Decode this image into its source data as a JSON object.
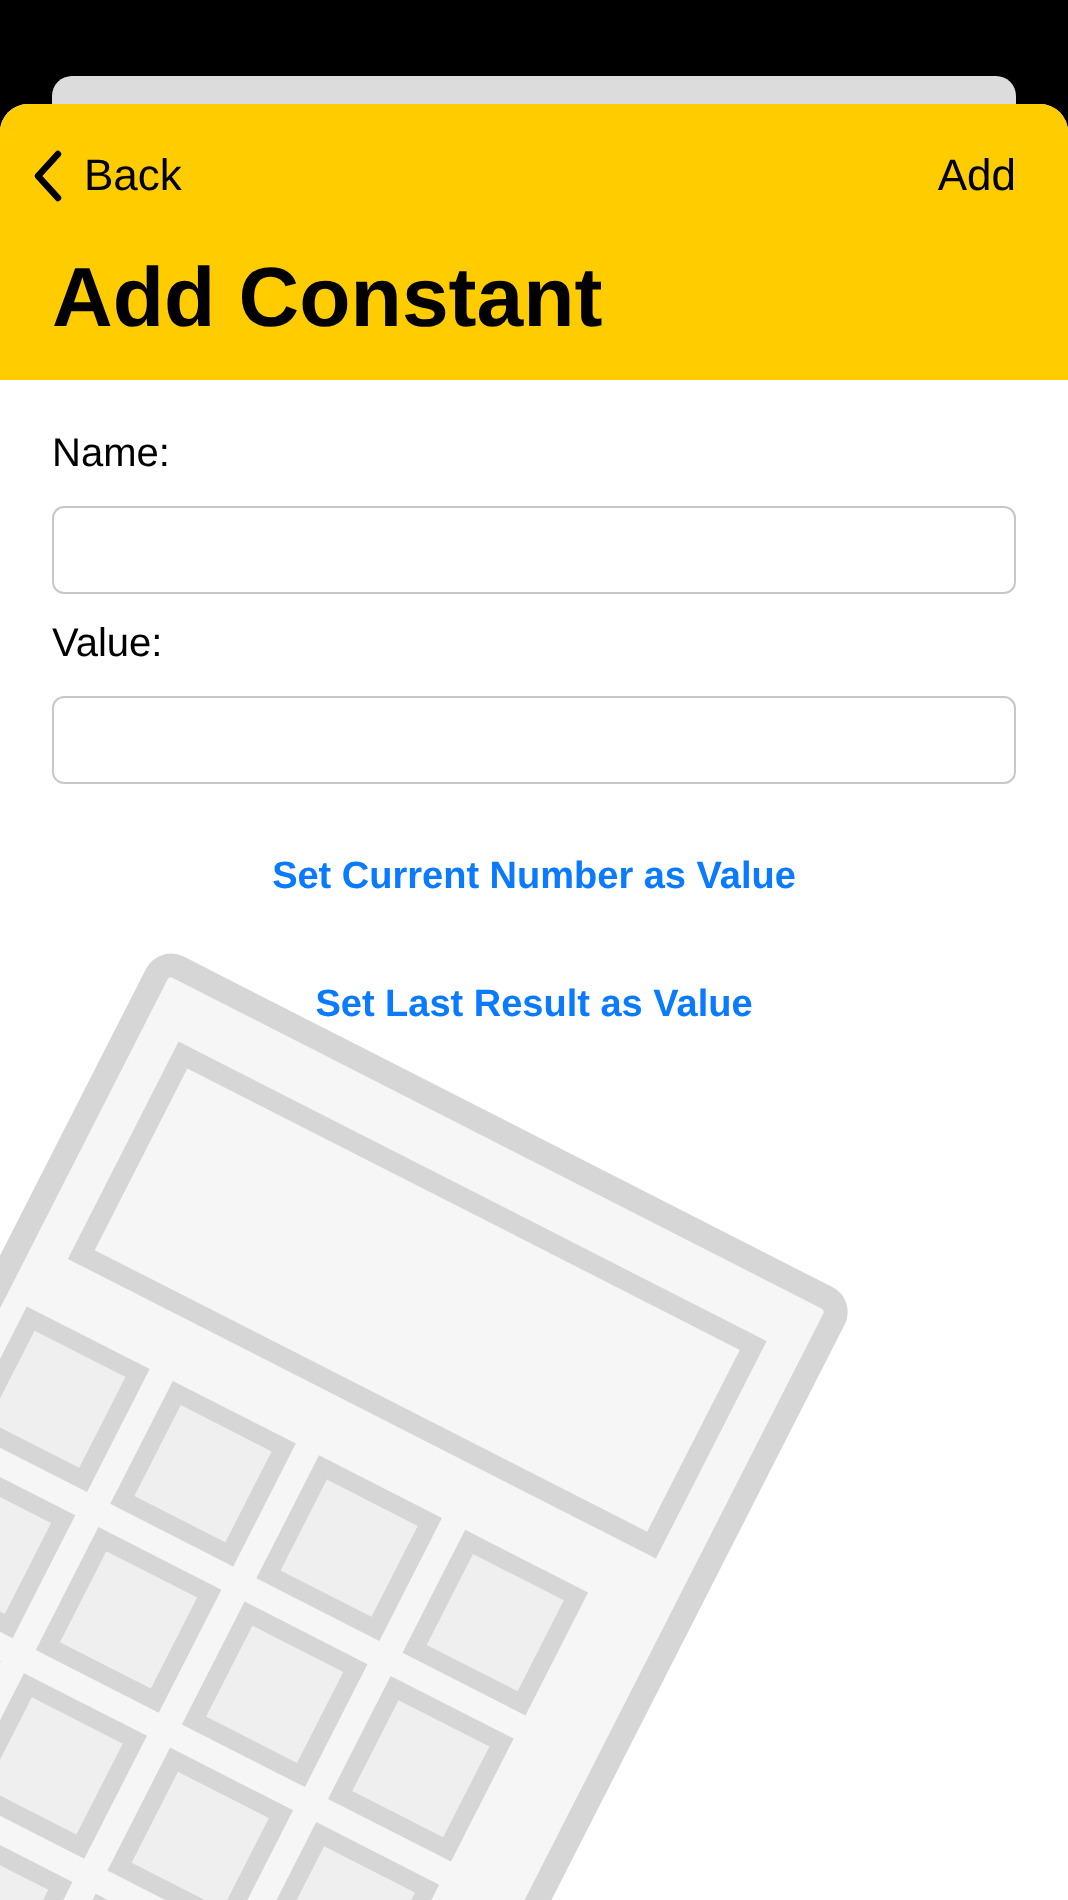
{
  "nav": {
    "back": "Back",
    "action": "Add"
  },
  "title": "Add Constant",
  "fields": [
    {
      "label": "Name:"
    },
    {
      "label": "Value:"
    }
  ],
  "links": [
    "Set Current Number as Value",
    "Set Last Result as Value"
  ]
}
